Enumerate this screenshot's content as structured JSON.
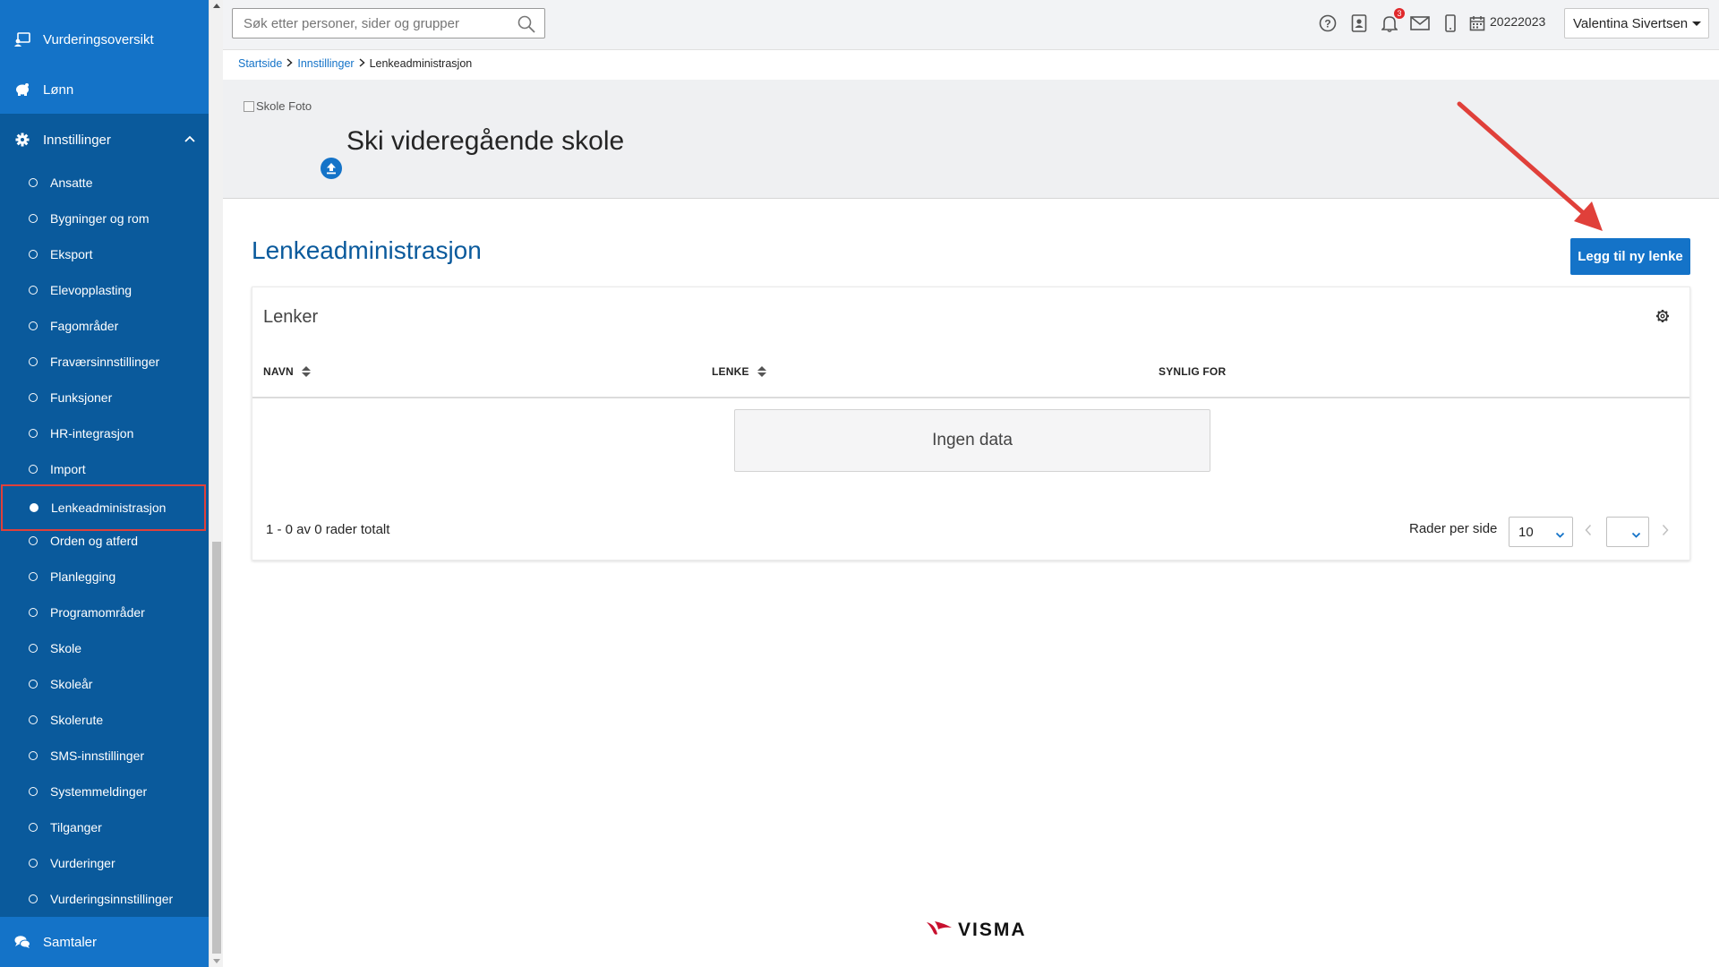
{
  "sidebar": {
    "top_items": [
      {
        "label": "Vurderingsoversikt"
      },
      {
        "label": "Lønn"
      }
    ],
    "settings": {
      "label": "Innstillinger"
    },
    "sub_items": [
      {
        "label": "Ansatte"
      },
      {
        "label": "Bygninger og rom"
      },
      {
        "label": "Eksport"
      },
      {
        "label": "Elevopplasting"
      },
      {
        "label": "Fagområder"
      },
      {
        "label": "Fraværsinnstillinger"
      },
      {
        "label": "Funksjoner"
      },
      {
        "label": "HR-integrasjon"
      },
      {
        "label": "Import"
      },
      {
        "label": "Lenkeadministrasjon"
      },
      {
        "label": "Orden og atferd"
      },
      {
        "label": "Planlegging"
      },
      {
        "label": "Programområder"
      },
      {
        "label": "Skole"
      },
      {
        "label": "Skoleår"
      },
      {
        "label": "Skolerute"
      },
      {
        "label": "SMS-innstillinger"
      },
      {
        "label": "Systemmeldinger"
      },
      {
        "label": "Tilganger"
      },
      {
        "label": "Vurderinger"
      },
      {
        "label": "Vurderingsinnstillinger"
      }
    ],
    "bottom_item": {
      "label": "Samtaler"
    },
    "active_item": "Lenkeadministrasjon"
  },
  "topbar": {
    "search_placeholder": "Søk etter personer, sider og grupper",
    "notification_count": "3",
    "school_year": "20222023",
    "user_name": "Valentina Sivertsen"
  },
  "breadcrumb": {
    "home": "Startside",
    "parent": "Innstillinger",
    "current": "Lenkeadministrasjon"
  },
  "school": {
    "photo_alt": "Skole Foto",
    "name": "Ski videregående skole"
  },
  "page": {
    "title": "Lenkeadministrasjon",
    "add_button": "Legg til ny lenke"
  },
  "table": {
    "title": "Lenker",
    "columns": [
      "NAVN",
      "LENKE",
      "SYNLIG FOR"
    ],
    "empty_text": "Ingen data",
    "rows_total": "1 - 0 av 0 rader totalt",
    "rows_per_page_label": "Rader per side",
    "rows_per_page_value": "10",
    "page_value": ""
  },
  "footer": {
    "logo_text": "VISMA"
  },
  "colors": {
    "sidebar_dark": "#0a5a9c",
    "sidebar_light": "#1473c8",
    "accent": "#1473c8",
    "highlight": "#e0403a"
  }
}
